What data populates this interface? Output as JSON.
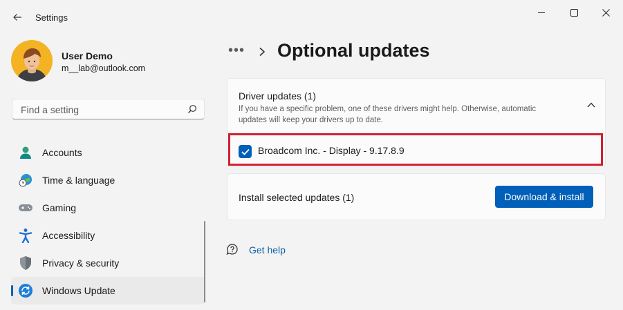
{
  "window": {
    "title": "Settings"
  },
  "user": {
    "name": "User Demo",
    "email": "m__lab@outlook.com"
  },
  "search": {
    "placeholder": "Find a setting",
    "value": ""
  },
  "sidebar": {
    "items": [
      {
        "label": "Accounts",
        "icon": "accounts-icon"
      },
      {
        "label": "Time & language",
        "icon": "time-language-icon"
      },
      {
        "label": "Gaming",
        "icon": "gaming-icon"
      },
      {
        "label": "Accessibility",
        "icon": "accessibility-icon"
      },
      {
        "label": "Privacy & security",
        "icon": "shield-icon"
      },
      {
        "label": "Windows Update",
        "icon": "windows-update-icon",
        "active": true
      }
    ]
  },
  "breadcrumb": {
    "dots": "•••"
  },
  "page": {
    "title": "Optional updates"
  },
  "driver_updates": {
    "title": "Driver updates (1)",
    "description": "If you have a specific problem, one of these drivers might help. Otherwise, automatic updates will keep your drivers up to date.",
    "items": [
      {
        "label": "Broadcom Inc. - Display - 9.17.8.9",
        "checked": true
      }
    ]
  },
  "install": {
    "label": "Install selected updates (1)",
    "button": "Download & install"
  },
  "help": {
    "label": "Get help"
  },
  "colors": {
    "accent": "#005fb8",
    "highlight": "#d0202f",
    "background": "#f3f3f3"
  }
}
